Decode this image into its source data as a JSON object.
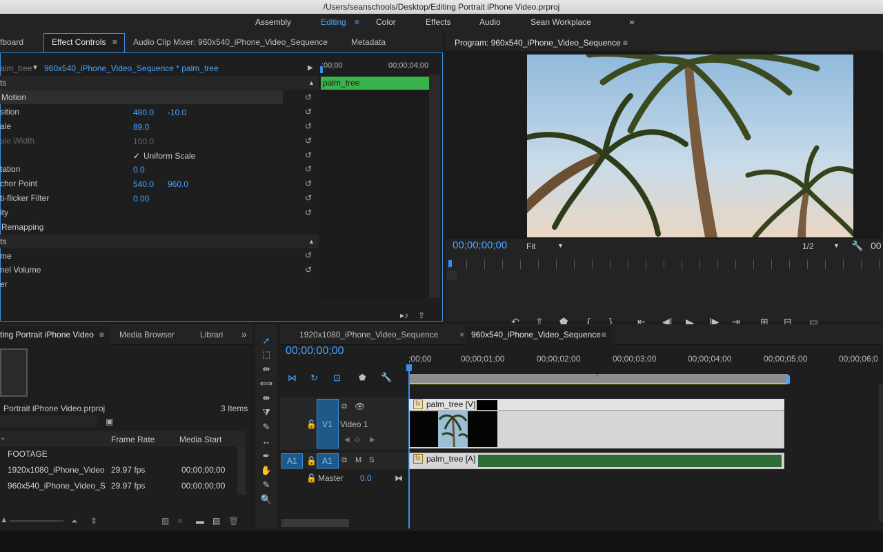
{
  "window_title": "/Users/seanschools/Desktop/Editing Portrait iPhone Video.prproj",
  "workspaces": [
    "Assembly",
    "Editing",
    "Color",
    "Effects",
    "Audio",
    "Sean Workplace"
  ],
  "more_symbol": "»",
  "effect_controls": {
    "tabs": [
      "fboard",
      "Effect Controls",
      "Audio Clip Mixer: 960x540_iPhone_Video_Sequence",
      "Metadata"
    ],
    "source_clip": "alm_tree",
    "sequence_clip": "960x540_iPhone_Video_Sequence * palm_tree",
    "timecode_start": ";00;00",
    "timecode_end": "00;00;04;00",
    "clip_bar_label": "palm_tree",
    "video_effects_header": "ts",
    "motion": "Motion",
    "position_label": "sition",
    "position_x": "480.0",
    "position_y": "-10.0",
    "scale_label": "ale",
    "scale_value": "89.0",
    "scale_width_label": "ale Width",
    "scale_width_value": "100.0",
    "uniform_scale_label": "Uniform Scale",
    "rotation_label": "tation",
    "rotation_value": "0.0",
    "anchor_label": "chor Point",
    "anchor_x": "540.0",
    "anchor_y": "960.0",
    "antiflicker_label": "ti-flicker Filter",
    "antiflicker_value": "0.00",
    "opacity_label": "ity",
    "remap_label": "Remapping",
    "audio_effects_header": "ts",
    "volume_label": "me",
    "channel_volume_label": "nel Volume",
    "panner_label": "er"
  },
  "program_monitor": {
    "title": "Program: 960x540_iPhone_Video_Sequence",
    "timecode": "00;00;00;00",
    "fit": "Fit",
    "resolution": "1/2",
    "duration_partial": "00"
  },
  "project_panel": {
    "tabs": [
      "ting Portrait iPhone Video",
      "Media Browser",
      "Librari"
    ],
    "project_file": "Portrait iPhone Video.prproj",
    "item_count": "3 Items",
    "columns": [
      "Frame Rate",
      "Media Start"
    ],
    "folder": "FOOTAGE",
    "items": [
      {
        "name": "1920x1080_iPhone_Video",
        "fps": "29.97 fps",
        "start": "00;00;00;00"
      },
      {
        "name": "960x540_iPhone_Video_S",
        "fps": "29.97 fps",
        "start": "00;00;00;00"
      }
    ]
  },
  "timeline": {
    "tabs": [
      "1920x1080_iPhone_Video_Sequence",
      "960x540_iPhone_Video_Sequence"
    ],
    "timecode": "00;00;00;00",
    "ruler": [
      ";00;00",
      "00;00;01;00",
      "00;00;02;00",
      "00;00;03;00",
      "00;00;04;00",
      "00;00;05;00",
      "00;00;06;0"
    ],
    "v1_label": "V1",
    "v1_name": "Video 1",
    "a1_source": "A1",
    "a1_label": "A1",
    "mute": "M",
    "solo": "S",
    "master_label": "Master",
    "master_value": "0.0",
    "video_clip": "palm_tree [V]",
    "audio_clip": "palm_tree [A]",
    "fx_badge": "fx",
    "loop_marker": "″"
  }
}
